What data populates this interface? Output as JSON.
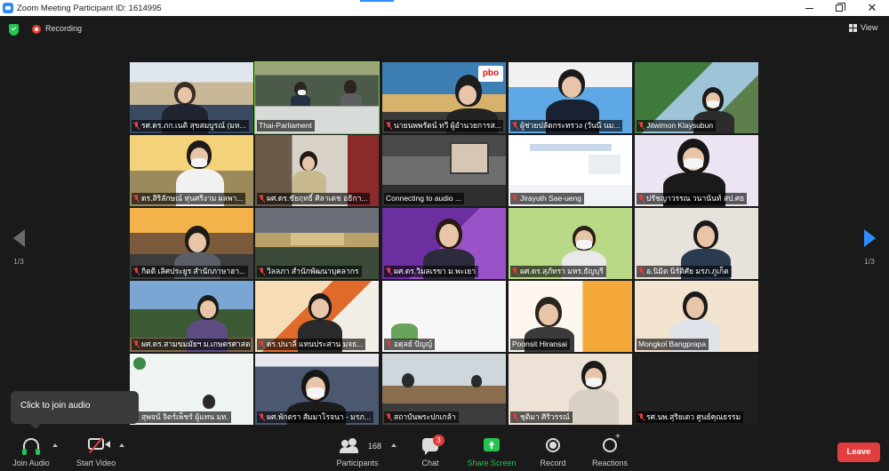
{
  "window": {
    "title": "Zoom Meeting Participant ID: 1614995",
    "controls": [
      "minimize-icon",
      "maximize-icon",
      "close-icon"
    ]
  },
  "status": {
    "recording_label": "Recording",
    "view_label": "View"
  },
  "page": {
    "label_left": "1/3",
    "label_right": "1/3"
  },
  "colors": {
    "active_speaker_border": "#7ad53c",
    "accent_blue": "#2d8cff",
    "leave_red": "#e23e3e",
    "share_green": "#23c552"
  },
  "participants": [
    {
      "name": "รศ.ดร.ภก.เนติ สุขสมบูรณ์ (มห...",
      "muted": true
    },
    {
      "name": "Thai-Parliament",
      "muted": false,
      "active": true
    },
    {
      "name": "นายนพพรัตน์ ทวี ผู้อำนวยการส...",
      "muted": true
    },
    {
      "name": "ผู้ช่วยปลัดกระทรวง (วันนี  นม...",
      "muted": true
    },
    {
      "name": "Jitwimon Klaysubun",
      "muted": true
    },
    {
      "name": "ดร.สิริลักษณ์ หุ่นศรีงาม ผลพา...",
      "muted": true
    },
    {
      "name": "ผศ.ดร.ชัยฤทธิ์ ศิลาเดช อธิกา...",
      "muted": true
    },
    {
      "name": "Connecting to audio ...",
      "muted": false
    },
    {
      "name": "Jirayuth Sae-ueng",
      "muted": true
    },
    {
      "name": "ปรัชญาวรรณ วนานันท์ สป.ศธ",
      "muted": true
    },
    {
      "name": "กิตติ เลิศประยูร สำนักภาษาฮา...",
      "muted": true
    },
    {
      "name": "วิลลภา สำนักพัฒนาบุคลากร",
      "muted": true
    },
    {
      "name": "ผศ.ดร.วิมลเรขา ม.พะเยา",
      "muted": true
    },
    {
      "name": "ผศ.ดร.สุภัทรา มหร.ธัญบุรี",
      "muted": true
    },
    {
      "name": "อ.นิมิต นิรัติศัย มรภ.ภูเก็ต",
      "muted": true
    },
    {
      "name": "ผศ.ดร.สามขมมัยฯ ม.เกษตรศาสต...",
      "muted": true
    },
    {
      "name": "ดร.ปนาลี แทนประสาน มจธ...",
      "muted": true
    },
    {
      "name": "อดุลย์ ปัญญ์",
      "muted": true
    },
    {
      "name": "Poonsit Hiransai",
      "muted": true
    },
    {
      "name": "Mongkol Bangprapa",
      "muted": true
    },
    {
      "name": "สุพจน์ จิตร์เพ็ชร์ ผู้แทน มท.",
      "muted": true
    },
    {
      "name": "ผศ.พักตรา สัมมาโรจนา - มรภ...",
      "muted": true
    },
    {
      "name": "สถาบันพระปกเกล้า",
      "muted": true
    },
    {
      "name": "ชุติมา ศิริวรรณ์",
      "muted": true
    },
    {
      "name": "รศ.นพ.สุริยเดว ศูนย์คุณธรรม",
      "muted": true
    }
  ],
  "tooltip": {
    "text": "Click to join audio"
  },
  "toolbar": {
    "join_audio": "Join Audio",
    "start_video": "Start Video",
    "participants_label": "Participants",
    "participants_count": "168",
    "chat_label": "Chat",
    "chat_badge": "3",
    "share_label": "Share Screen",
    "record_label": "Record",
    "reactions_label": "Reactions",
    "leave_label": "Leave"
  }
}
